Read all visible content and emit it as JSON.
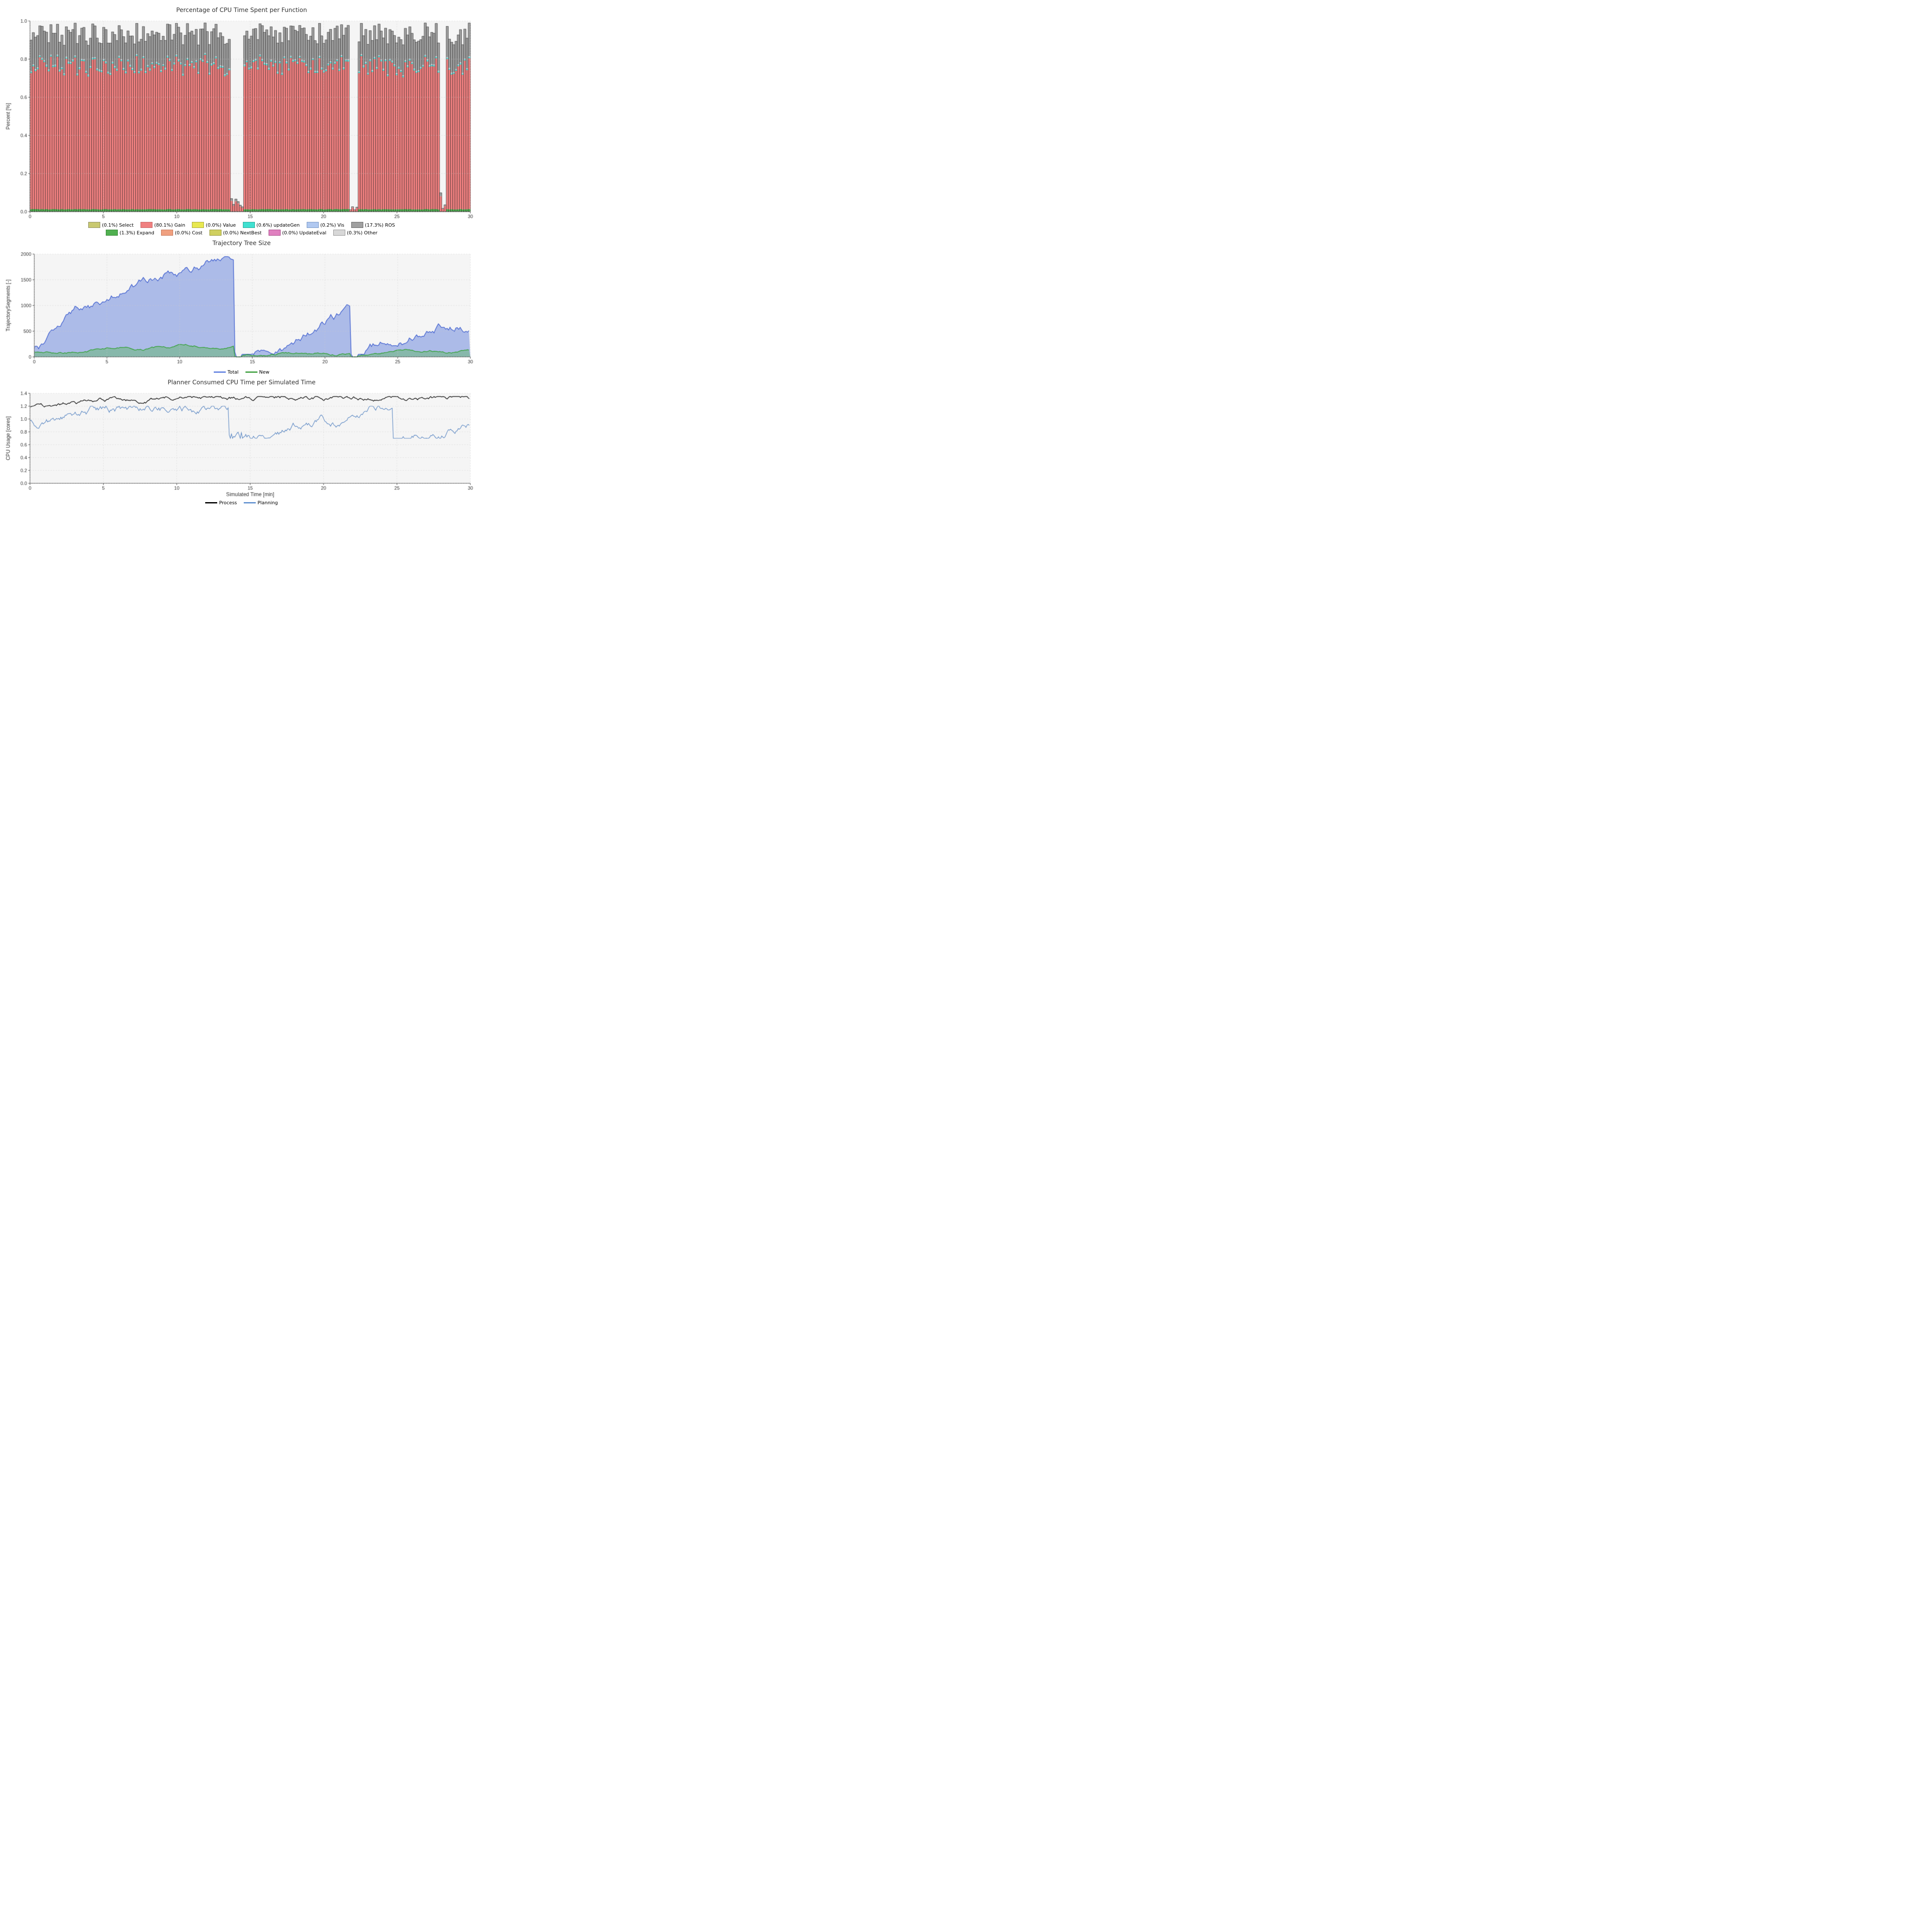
{
  "charts": {
    "cpu_time": {
      "title": "Percentage of CPU Time Spent per Function",
      "x_label": "",
      "y_label": "Percent [%]",
      "x_min": 0,
      "x_max": 30,
      "y_min": 0.0,
      "y_max": 1.0,
      "legend": [
        {
          "label": "(0.1%) Select",
          "color": "#c8c870",
          "border": "#888860"
        },
        {
          "label": "(80.1%) Gain",
          "color": "#f08080",
          "border": "#c06060"
        },
        {
          "label": "(0.0%) Value",
          "color": "#e8e850",
          "border": "#a0a030"
        },
        {
          "label": "(0.6%) updateGen",
          "color": "#40e0d0",
          "border": "#20a090"
        },
        {
          "label": "(0.2%) Vis",
          "color": "#b0c8f0",
          "border": "#7090c0"
        },
        {
          "label": "(17.3%) ROS",
          "color": "#a0a0a0",
          "border": "#606060"
        },
        {
          "label": "(1.3%) Expand",
          "color": "#50b050",
          "border": "#308030"
        },
        {
          "label": "(0.0%) Cost",
          "color": "#f0a080",
          "border": "#c07050"
        },
        {
          "label": "(0.0%) NextBest",
          "color": "#d0d060",
          "border": "#909030"
        },
        {
          "label": "(0.0%) UpdateEval",
          "color": "#e080c0",
          "border": "#a04080"
        },
        {
          "label": "(0.3%) Other",
          "color": "#d8d8d8",
          "border": "#909090"
        }
      ]
    },
    "trajectory_tree": {
      "title": "Trajectory Tree Size",
      "x_label": "",
      "y_label": "TrajectorySegments [-]",
      "x_min": 0,
      "x_max": 30,
      "y_min": 0,
      "y_max": 2000,
      "legend": [
        {
          "label": "Total",
          "color": "#6080e0",
          "type": "line"
        },
        {
          "label": "New",
          "color": "#40a040",
          "type": "line"
        }
      ]
    },
    "cpu_usage": {
      "title": "Planner Consumed CPU Time per Simulated Time",
      "x_label": "Simulated Time [min]",
      "y_label": "CPU Usage [cores]",
      "x_min": 0,
      "x_max": 30,
      "y_min": 0.0,
      "y_max": 1.4,
      "legend": [
        {
          "label": "Process",
          "color": "#000000",
          "type": "line"
        },
        {
          "label": "Planning",
          "color": "#6090d0",
          "type": "line"
        }
      ]
    }
  }
}
